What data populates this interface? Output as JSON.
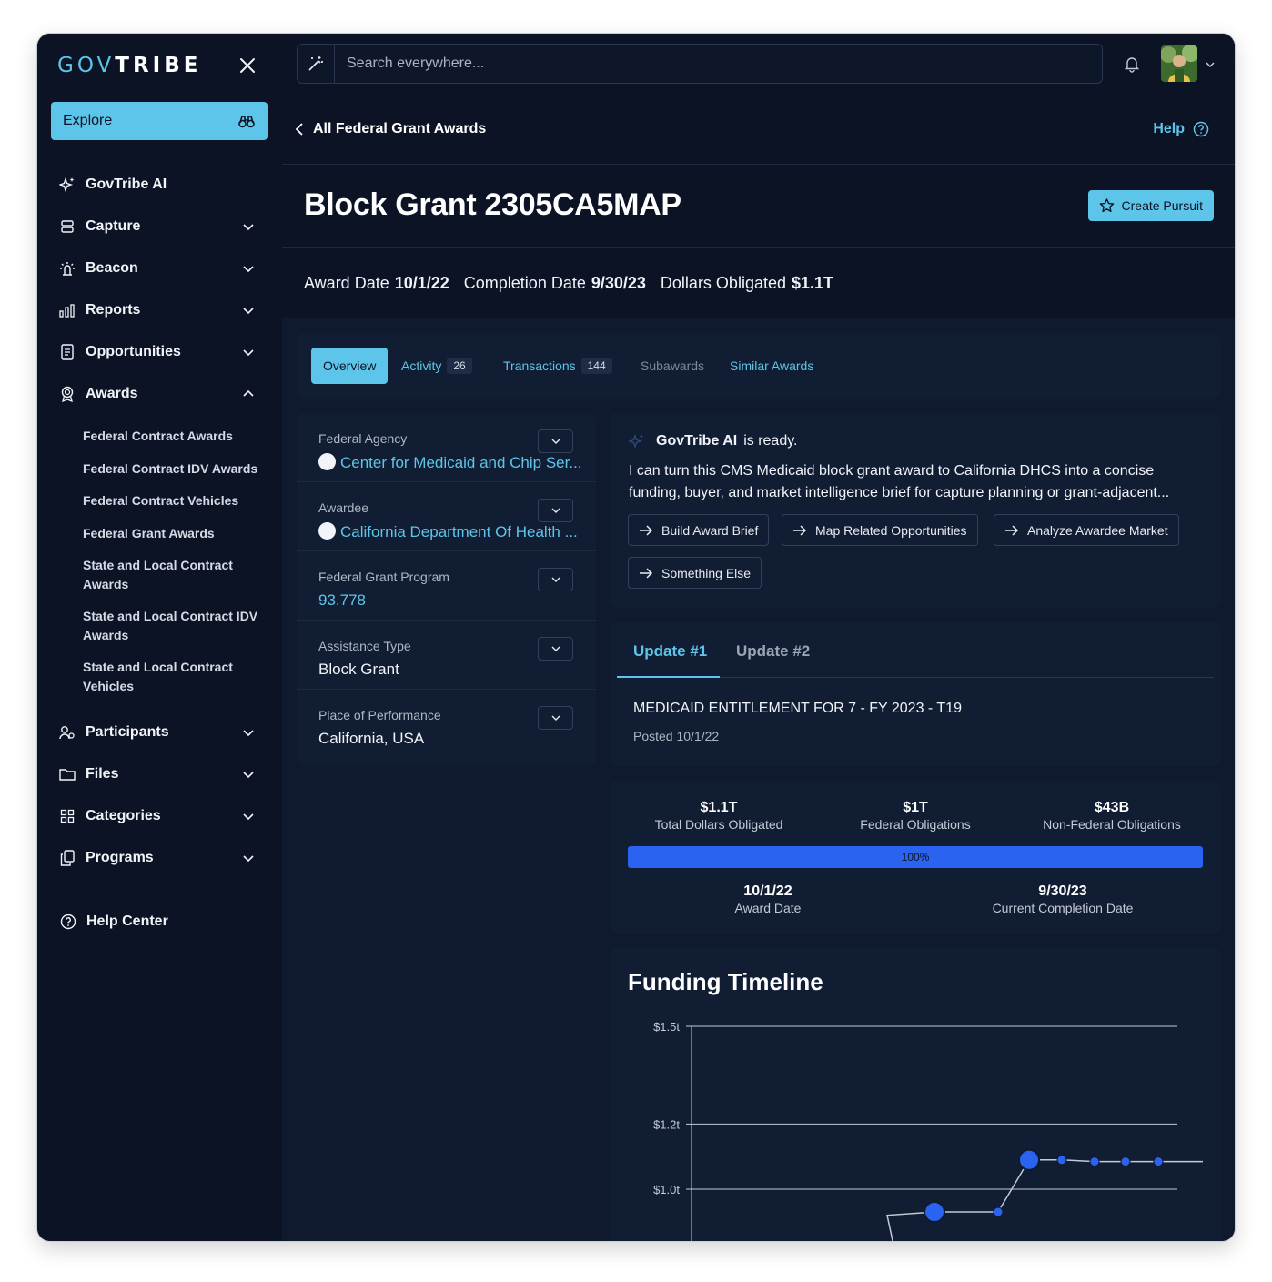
{
  "brand": {
    "gov": "GOV",
    "tribe": "TRIBE"
  },
  "sidebar": {
    "explore_label": "Explore",
    "items": [
      {
        "label": "GovTribe AI",
        "icon": "sparkles-icon"
      },
      {
        "label": "Capture",
        "icon": "database-icon"
      },
      {
        "label": "Beacon",
        "icon": "beacon-icon"
      },
      {
        "label": "Reports",
        "icon": "bar-chart-icon"
      },
      {
        "label": "Opportunities",
        "icon": "document-icon"
      },
      {
        "label": "Awards",
        "icon": "award-icon"
      },
      {
        "label": "Participants",
        "icon": "users-icon"
      },
      {
        "label": "Files",
        "icon": "folder-icon"
      },
      {
        "label": "Categories",
        "icon": "grid-icon"
      },
      {
        "label": "Programs",
        "icon": "copy-icon"
      }
    ],
    "award_subitems": [
      "Federal Contract Awards",
      "Federal Contract IDV Awards",
      "Federal Contract Vehicles",
      "Federal Grant Awards",
      "State and Local Contract Awards",
      "State and Local Contract IDV Awards",
      "State and Local Contract Vehicles"
    ],
    "help_center": "Help Center"
  },
  "search": {
    "placeholder": "Search everywhere..."
  },
  "header": {
    "back_label": "All Federal Grant Awards",
    "help_label": "Help",
    "title": "Block Grant 2305CA5MAP",
    "create_pursuit": "Create Pursuit",
    "award_date_label": "Award Date",
    "award_date": "10/1/22",
    "completion_date_label": "Completion Date",
    "completion_date": "9/30/23",
    "dollars_label": "Dollars Obligated",
    "dollars": "$1.1T"
  },
  "tabs": [
    {
      "label": "Overview"
    },
    {
      "label": "Activity",
      "count": "26"
    },
    {
      "label": "Transactions",
      "count": "144"
    },
    {
      "label": "Subawards"
    },
    {
      "label": "Similar Awards"
    }
  ],
  "details": [
    {
      "label": "Federal Agency",
      "value": "Center for Medicaid and Chip Ser..."
    },
    {
      "label": "Awardee",
      "value": "California Department Of Health ..."
    },
    {
      "label": "Federal Grant Program",
      "value": "93.778"
    },
    {
      "label": "Assistance Type",
      "value": "Block Grant"
    },
    {
      "label": "Place of Performance",
      "value": "California, USA"
    }
  ],
  "ai": {
    "name": "GovTribe AI",
    "status": "is ready.",
    "message": "I can turn this CMS Medicaid block grant award to California DHCS into a concise funding, buyer, and market intelligence brief for capture planning or grant-adjacent...",
    "chips": [
      "Build Award Brief",
      "Map Related Opportunities",
      "Analyze Awardee Market",
      "Something Else"
    ]
  },
  "updates": {
    "tabs": [
      "Update #1",
      "Update #2"
    ],
    "title": "MEDICAID ENTITLEMENT FOR 7 - FY 2023 - T19",
    "posted": "Posted 10/1/22"
  },
  "stats": {
    "total": {
      "value": "$1.1T",
      "label": "Total Dollars Obligated"
    },
    "federal": {
      "value": "$1T",
      "label": "Federal Obligations"
    },
    "nonfederal": {
      "value": "$43B",
      "label": "Non-Federal Obligations"
    },
    "progress_label": "100%",
    "progress": 1.0,
    "award_date": {
      "value": "10/1/22",
      "label": "Award Date"
    },
    "completion": {
      "value": "9/30/23",
      "label": "Current Completion Date"
    }
  },
  "chart_data": {
    "type": "line",
    "title": "Funding Timeline",
    "y_ticks": [
      {
        "label": "$1.5t",
        "value": 1.5
      },
      {
        "label": "$1.2t",
        "value": 1.2
      },
      {
        "label": "$1.0t",
        "value": 1.0
      }
    ],
    "series": [
      {
        "values": [
          0.92,
          0.93,
          0.93,
          1.09,
          1.09,
          1.085,
          1.085,
          1.085,
          1.085
        ]
      }
    ],
    "large_points": [
      1,
      3
    ],
    "colors": {
      "line": "#c3cad6",
      "point": "#2a63f0",
      "grid": "#c3cad6"
    }
  }
}
